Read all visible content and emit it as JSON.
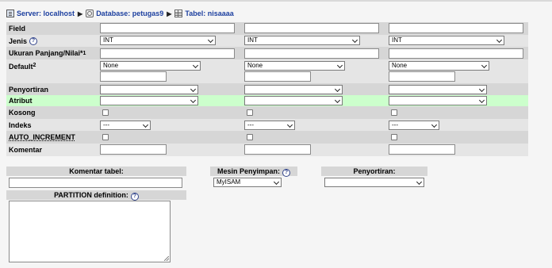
{
  "breadcrumb": {
    "server": "Server: localhost",
    "database": "Database: petugas9",
    "table": "Tabel: nisaaaa"
  },
  "labels": {
    "field": "Field",
    "jenis": "Jenis",
    "ukuran": "Ukuran Panjang/Nilai*",
    "ukuran_sup": "1",
    "default": "Default",
    "default_sup": "2",
    "penyortiran": "Penyortiran",
    "atribut": "Atribut",
    "kosong": "Kosong",
    "indeks": "Indeks",
    "auto_increment": "AUTO_INCREMENT",
    "komentar": "Komentar"
  },
  "columns": [
    {
      "field": "",
      "jenis": "INT",
      "ukuran": "",
      "default": "None",
      "default_value": "",
      "penyortiran": "",
      "atribut": "",
      "indeks": "---",
      "komentar": ""
    },
    {
      "field": "",
      "jenis": "INT",
      "ukuran": "",
      "default": "None",
      "default_value": "",
      "penyortiran": "",
      "atribut": "",
      "indeks": "---",
      "komentar": ""
    },
    {
      "field": "",
      "jenis": "INT",
      "ukuran": "",
      "default": "None",
      "default_value": "",
      "penyortiran": "",
      "atribut": "",
      "indeks": "---",
      "komentar": ""
    }
  ],
  "bottom": {
    "komentar_tabel": "Komentar tabel:",
    "mesin_penyimpan": "Mesin Penyimpan:",
    "mesin_value": "MyISAM",
    "penyortiran": "Penyortiran:",
    "penyortiran_value": "",
    "partition": "PARTITION definition:",
    "komentar_tabel_value": "",
    "partition_value": ""
  },
  "help_glyph": "?",
  "colors": {
    "link": "#1c3f9f",
    "row_dark": "#d6d6d6",
    "row_light": "#e5e5e5",
    "attribute_highlight": "#ccffcc"
  }
}
